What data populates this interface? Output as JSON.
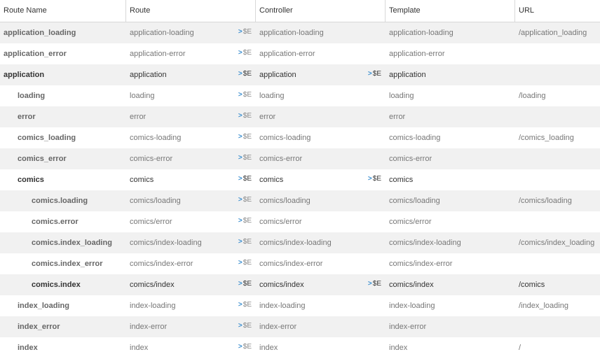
{
  "headers": [
    "Route Name",
    "Route",
    "Controller",
    "Template",
    "URL"
  ],
  "send_to_console": {
    "chevron": ">",
    "label": "$E"
  },
  "rows": [
    {
      "name": "application_loading",
      "route": "application-loading",
      "controller": "application-loading",
      "template": "application-loading",
      "url": "/application_loading"
    },
    {
      "name": "application_error",
      "route": "application-error",
      "controller": "application-error",
      "template": "application-error",
      "url": ""
    },
    {
      "name": "application",
      "route": "application",
      "controller": "application",
      "template": "application",
      "url": ""
    },
    {
      "name": "loading",
      "route": "loading",
      "controller": "loading",
      "template": "loading",
      "url": "/loading"
    },
    {
      "name": "error",
      "route": "error",
      "controller": "error",
      "template": "error",
      "url": ""
    },
    {
      "name": "comics_loading",
      "route": "comics-loading",
      "controller": "comics-loading",
      "template": "comics-loading",
      "url": "/comics_loading"
    },
    {
      "name": "comics_error",
      "route": "comics-error",
      "controller": "comics-error",
      "template": "comics-error",
      "url": ""
    },
    {
      "name": "comics",
      "route": "comics",
      "controller": "comics",
      "template": "comics",
      "url": ""
    },
    {
      "name": "comics.loading",
      "route": "comics/loading",
      "controller": "comics/loading",
      "template": "comics/loading",
      "url": "/comics/loading"
    },
    {
      "name": "comics.error",
      "route": "comics/error",
      "controller": "comics/error",
      "template": "comics/error",
      "url": ""
    },
    {
      "name": "comics.index_loading",
      "route": "comics/index-loading",
      "controller": "comics/index-loading",
      "template": "comics/index-loading",
      "url": "/comics/index_loading"
    },
    {
      "name": "comics.index_error",
      "route": "comics/index-error",
      "controller": "comics/index-error",
      "template": "comics/index-error",
      "url": ""
    },
    {
      "name": "comics.index",
      "route": "comics/index",
      "controller": "comics/index",
      "template": "comics/index",
      "url": "/comics"
    },
    {
      "name": "index_loading",
      "route": "index-loading",
      "controller": "index-loading",
      "template": "index-loading",
      "url": "/index_loading"
    },
    {
      "name": "index_error",
      "route": "index-error",
      "controller": "index-error",
      "template": "index-error",
      "url": ""
    },
    {
      "name": "index",
      "route": "index",
      "controller": "index",
      "template": "index",
      "url": "/"
    }
  ]
}
